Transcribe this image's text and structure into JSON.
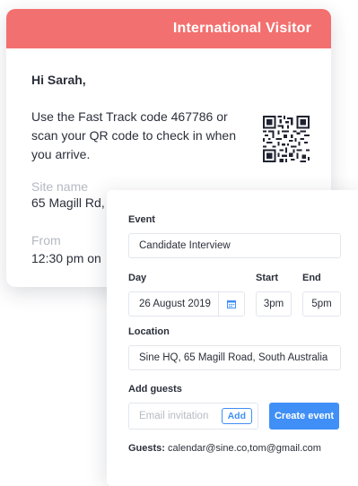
{
  "visitor_card": {
    "header": "International Visitor",
    "greeting": "Hi Sarah,",
    "message": "Use the Fast Track code 467786 or scan your QR code to check in when you arrive.",
    "site_label": "Site name",
    "site_value": "65 Magill Rd,",
    "from_label": "From",
    "from_value": "12:30 pm on",
    "qr_icon": "qr-code-icon"
  },
  "event_form": {
    "event_label": "Event",
    "event_value": "Candidate Interview",
    "day_label": "Day",
    "day_value": "26 August 2019",
    "start_label": "Start",
    "start_value": "3pm",
    "end_label": "End",
    "end_value": "5pm",
    "location_label": "Location",
    "location_value": "Sine HQ, 65 Magill Road, South Australia",
    "guests_label": "Add guests",
    "email_placeholder": "Email invitation",
    "add_label": "Add",
    "create_label": "Create event",
    "guests_prefix": "Guests:",
    "guests_value": "calendar@sine.co,tom@gmail.com",
    "calendar_icon": "calendar-icon"
  },
  "colors": {
    "header": "#f2706f",
    "accent": "#3f8ff7",
    "muted": "#b4b8c1",
    "text": "#2b2f3a"
  }
}
